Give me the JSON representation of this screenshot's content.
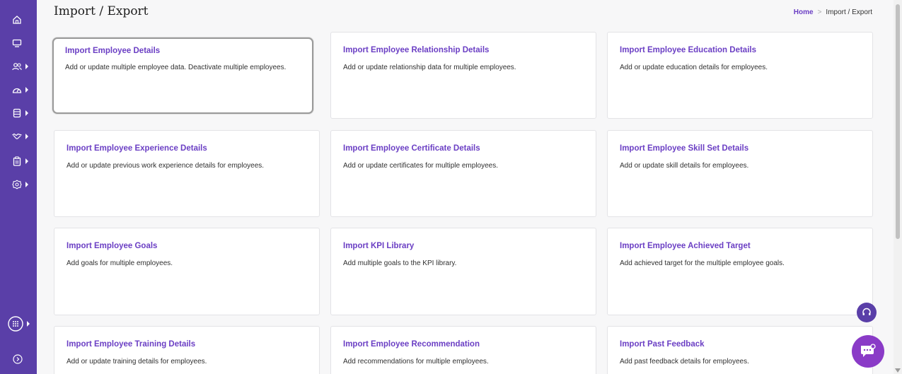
{
  "sidebar": {
    "items": [
      {
        "icon": "home-icon",
        "has_submenu": false
      },
      {
        "icon": "monitor-icon",
        "has_submenu": false
      },
      {
        "icon": "users-icon",
        "has_submenu": true
      },
      {
        "icon": "dashboard-gauge-icon",
        "has_submenu": true
      },
      {
        "icon": "database-icon",
        "has_submenu": true
      },
      {
        "icon": "handshake-icon",
        "has_submenu": true
      },
      {
        "icon": "clipboard-icon",
        "has_submenu": true
      },
      {
        "icon": "settings-icon",
        "has_submenu": true
      },
      {
        "icon": "apps-grid-icon",
        "has_submenu": true
      },
      {
        "icon": "expand-sidebar-icon",
        "has_submenu": false
      }
    ]
  },
  "header": {
    "title": "Import / Export",
    "breadcrumb": {
      "home": "Home",
      "separator": ">",
      "current": "Import / Export"
    }
  },
  "cards": [
    {
      "title": "Import Employee Details",
      "desc": "Add or update multiple employee data. Deactivate multiple employees."
    },
    {
      "title": "Import Employee Relationship Details",
      "desc": "Add or update relationship data for multiple employees."
    },
    {
      "title": "Import Employee Education Details",
      "desc": "Add or update education details for employees."
    },
    {
      "title": "Import Employee Experience Details",
      "desc": "Add or update previous work experience details for employees."
    },
    {
      "title": "Import Employee Certificate Details",
      "desc": "Add or update certificates for multiple employees."
    },
    {
      "title": "Import Employee Skill Set Details",
      "desc": "Add or update skill details for employees."
    },
    {
      "title": "Import Employee Goals",
      "desc": "Add goals for multiple employees."
    },
    {
      "title": "Import KPI Library",
      "desc": "Add multiple goals to the KPI library."
    },
    {
      "title": "Import Employee Achieved Target",
      "desc": "Add achieved target for the multiple employee goals."
    },
    {
      "title": "Import Employee Training Details",
      "desc": "Add or update training details for employees."
    },
    {
      "title": "Import Employee Recommendation",
      "desc": "Add recommendations for multiple employees."
    },
    {
      "title": "Import Past Feedback",
      "desc": "Add past feedback details for employees."
    }
  ],
  "floating": {
    "support_icon": "headset-icon",
    "chat_icon": "chat-icon"
  },
  "colors": {
    "sidebar": "#5a3fa8",
    "accent": "#6b3fc4",
    "chat_button": "#8a3bc7"
  }
}
